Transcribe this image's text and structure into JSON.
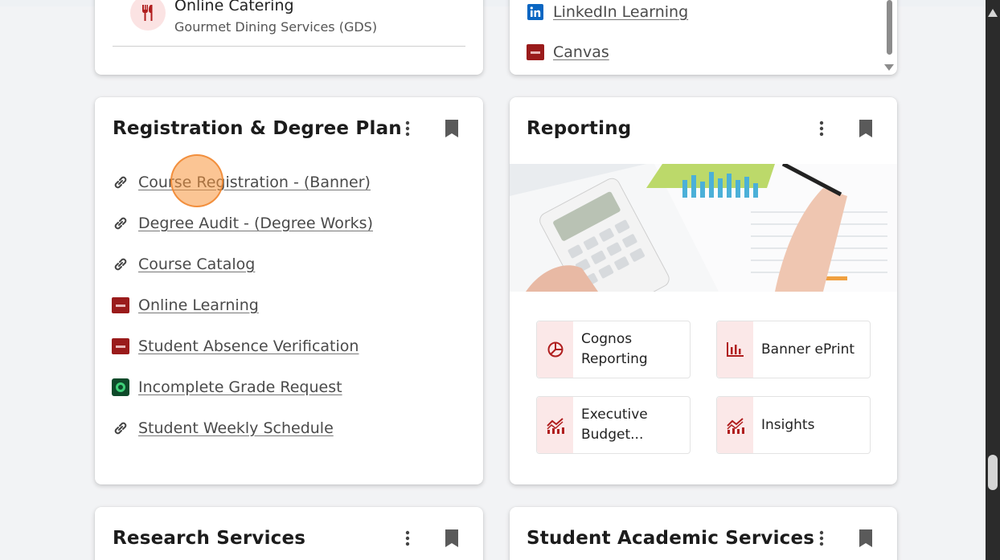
{
  "dining_card": {
    "item_title": "Online Catering",
    "item_subtitle": "Gourmet Dining Services (GDS)"
  },
  "learning_card": {
    "links": [
      {
        "label": "LinkedIn Learning",
        "icon": "linkedin-icon"
      },
      {
        "label": "Canvas",
        "icon": "canvas-logo-icon"
      }
    ]
  },
  "registration_card": {
    "title": "Registration & Degree Plan",
    "links": [
      {
        "label": "Course Registration - (Banner)",
        "icon": "link-icon"
      },
      {
        "label": "Degree Audit - (Degree Works)",
        "icon": "link-icon"
      },
      {
        "label": "Course Catalog",
        "icon": "link-icon"
      },
      {
        "label": "Online Learning",
        "icon": "university-logo-icon"
      },
      {
        "label": "Student Absence Verification",
        "icon": "university-logo-icon"
      },
      {
        "label": "Incomplete Grade Request",
        "icon": "green-ring-logo-icon"
      },
      {
        "label": "Student Weekly Schedule",
        "icon": "link-icon"
      }
    ]
  },
  "reporting_card": {
    "title": "Reporting",
    "tiles": [
      {
        "label": "Cognos Reporting",
        "icon": "pie-chart-icon"
      },
      {
        "label": "Banner ePrint",
        "icon": "bar-chart-icon"
      },
      {
        "label": "Executive Budget...",
        "icon": "analytics-icon"
      },
      {
        "label": "Insights",
        "icon": "analytics-icon"
      }
    ]
  },
  "research_card": {
    "title": "Research Services"
  },
  "academic_card": {
    "title": "Student Academic Services"
  },
  "colors": {
    "accent_red": "#b01e1e",
    "tile_icon_bg": "#fbe8e8",
    "link_text": "#4a4a4a"
  }
}
